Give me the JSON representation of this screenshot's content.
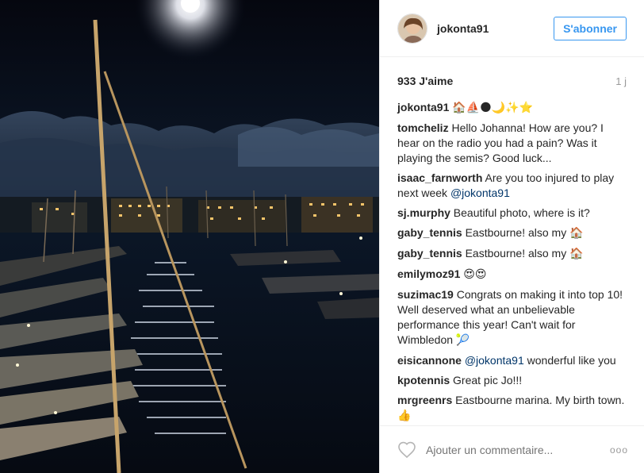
{
  "photo": {
    "alt": ""
  },
  "header": {
    "username": "jokonta91",
    "follow_label": "S'abonner"
  },
  "meta": {
    "likes": "933 J'aime",
    "time": "1 j"
  },
  "caption": {
    "author": "jokonta91",
    "text": "🏠⛵🌑🌙✨⭐"
  },
  "comments": [
    {
      "author": "tomcheliz",
      "parts": [
        {
          "t": "Hello Johanna! How are you? I hear on the radio you had a pain? Was it playing the semis? Good luck..."
        }
      ]
    },
    {
      "author": "isaac_farnworth",
      "parts": [
        {
          "t": "Are you too injured to play next week "
        },
        {
          "t": "@jokonta91",
          "mention": true
        }
      ]
    },
    {
      "author": "sj.murphy",
      "parts": [
        {
          "t": "Beautiful photo, where is it?"
        }
      ]
    },
    {
      "author": "gaby_tennis",
      "parts": [
        {
          "t": "Eastbourne! also my "
        },
        {
          "t": "🏠",
          "emoji": true
        }
      ]
    },
    {
      "author": "gaby_tennis",
      "parts": [
        {
          "t": "Eastbourne! also my "
        },
        {
          "t": "🏠",
          "emoji": true
        }
      ]
    },
    {
      "author": "emilymoz91",
      "parts": [
        {
          "t": "😍😍",
          "emoji": true
        }
      ]
    },
    {
      "author": "suzimac19",
      "parts": [
        {
          "t": "Congrats on making it into top 10! Well deserved what an unbelievable performance this year! Can't wait for Wimbledon "
        },
        {
          "t": "🎾",
          "emoji": true
        }
      ]
    },
    {
      "author": "eisicannone",
      "parts": [
        {
          "t": "@jokonta91",
          "mention": true
        },
        {
          "t": " wonderful like you"
        }
      ]
    },
    {
      "author": "kpotennis",
      "parts": [
        {
          "t": "Great pic Jo!!!"
        }
      ]
    },
    {
      "author": "mrgreenrs",
      "parts": [
        {
          "t": "Eastbourne marina. My birth town. "
        },
        {
          "t": "👍",
          "emoji": true
        }
      ]
    }
  ],
  "footer": {
    "placeholder": "Ajouter un commentaire...",
    "more": "ooo"
  }
}
